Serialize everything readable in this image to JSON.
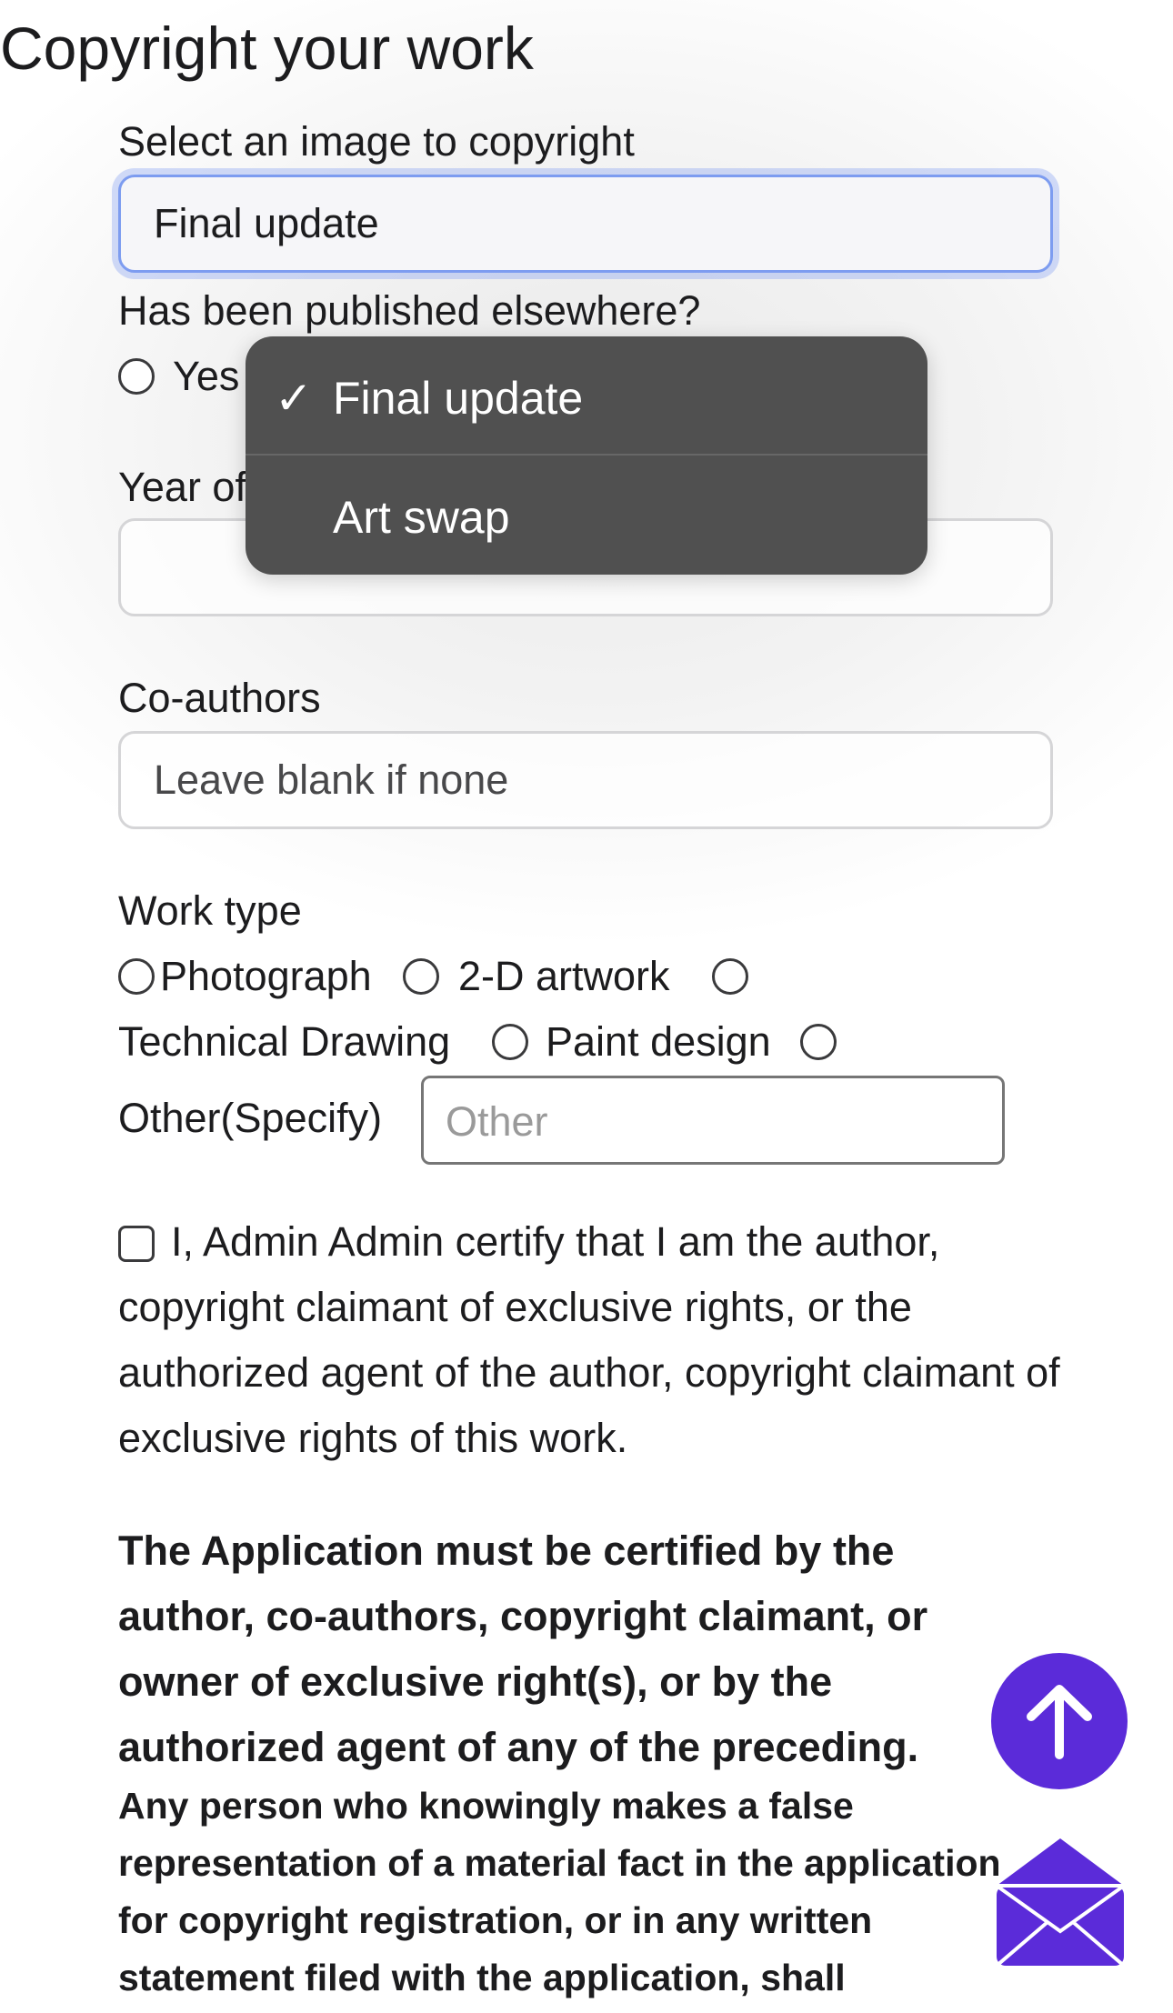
{
  "page": {
    "title": "Copyright your work"
  },
  "image_select": {
    "label": "Select an image to copyright",
    "value": "Final update"
  },
  "published": {
    "label": "Has been published elsewhere?",
    "yes_label": "Yes"
  },
  "year": {
    "label_visible": "Year of"
  },
  "coauthors": {
    "label": "Co-authors",
    "placeholder": "Leave blank if none"
  },
  "work_type": {
    "label": "Work type",
    "options": [
      "Photograph",
      "2-D artwork",
      "Technical Drawing",
      "Paint design",
      "Other(Specify)"
    ],
    "other_placeholder": "Other"
  },
  "certification": {
    "text": "I, Admin Admin certify that I am the author, copyright claimant of exclusive rights, or the authorized agent of the author, copyright claimant of exclusive rights of this work.",
    "checked": false
  },
  "notice": {
    "heading": "The Application must be certified by the author, co-authors, copyright claimant, or owner of exclusive right(s), or by the authorized agent of any of the preceding.",
    "warning": "Any person who knowingly makes a false representation of a material fact in the application for copyright registration, or in any written statement filed with the application, shall"
  },
  "dropdown": {
    "options": [
      {
        "label": "Final update",
        "selected": true,
        "check": "✓"
      },
      {
        "label": "Art swap",
        "selected": false,
        "check": ""
      }
    ]
  },
  "icons": {
    "scroll_top": "arrow-up-icon",
    "mail": "envelope-icon",
    "accent_color": "#5b2bd9"
  }
}
